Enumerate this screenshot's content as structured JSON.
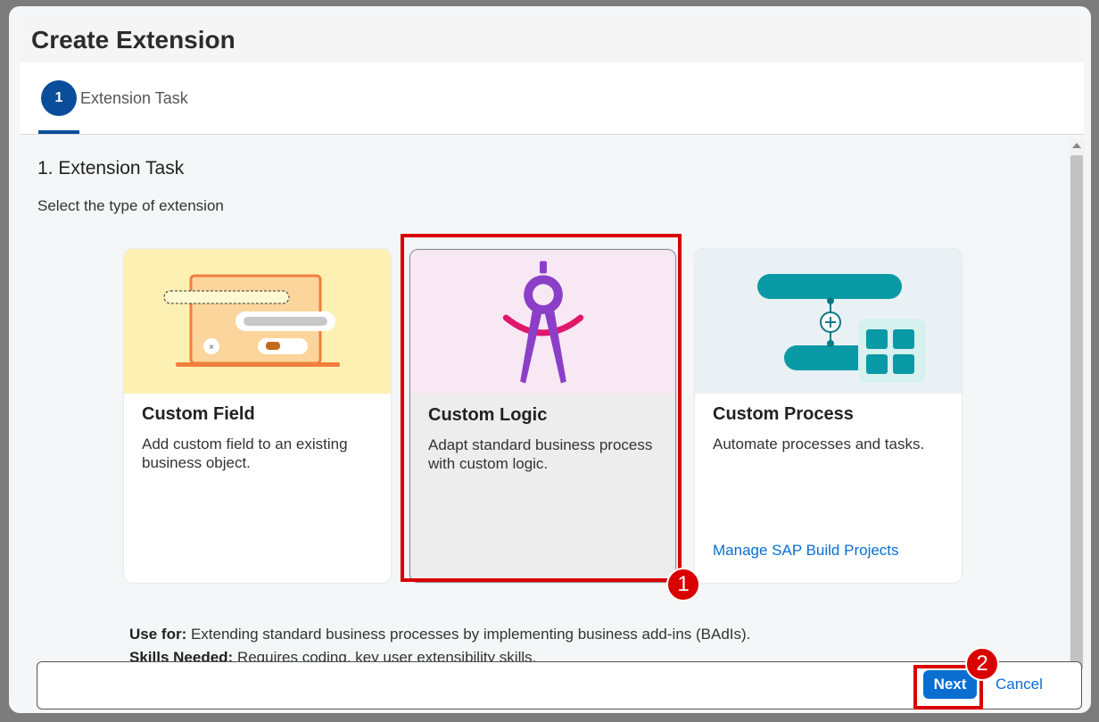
{
  "dialog": {
    "title": "Create Extension"
  },
  "wizard": {
    "steps": [
      {
        "number": "1",
        "label": "Extension Task"
      }
    ]
  },
  "content": {
    "section_title": "1. Extension Task",
    "section_subtitle": "Select the type of extension",
    "cards": [
      {
        "title": "Custom Field",
        "description": "Add custom field to an existing business object.",
        "link": ""
      },
      {
        "title": "Custom Logic",
        "description": "Adapt standard business process with custom logic.",
        "link": ""
      },
      {
        "title": "Custom Process",
        "description": "Automate processes and tasks.",
        "link": "Manage SAP Build Projects"
      }
    ],
    "use_for_label": "Use for:",
    "use_for_text": " Extending standard business processes by implementing business add-ins (BAdIs).",
    "skills_label": "Skills Needed:",
    "skills_text": " Requires coding, key user extensibility skills."
  },
  "footer": {
    "next_label": "Next",
    "cancel_label": "Cancel"
  },
  "annotations": {
    "badge1": "1",
    "badge2": "2"
  },
  "colors": {
    "brand": "#0a4e9b",
    "button": "#0a6ed1",
    "highlight": "#d90000"
  }
}
